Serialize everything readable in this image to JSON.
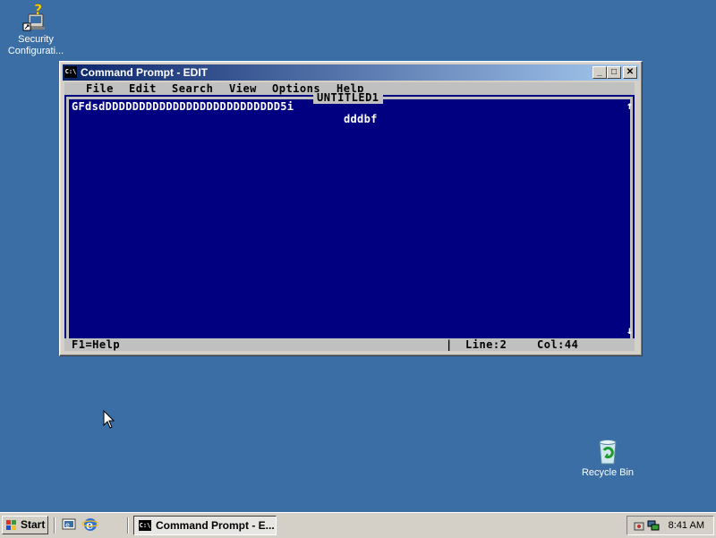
{
  "desktop": {
    "icons": [
      {
        "label": "Security Configurati..."
      },
      {
        "label": "Recycle Bin"
      }
    ]
  },
  "window": {
    "title": "Command Prompt - EDIT",
    "icon_text": "C:\\",
    "buttons": {
      "minimize": "_",
      "maximize": "□",
      "close": "✕"
    }
  },
  "editor": {
    "menu": [
      "File",
      "Edit",
      "Search",
      "View",
      "Options",
      "Help"
    ],
    "document_title": "UNTITLED1",
    "lines": [
      "GFdsdDDDDDDDDDDDDDDDDDDDDDDDDDD5i",
      "dddbf"
    ],
    "scroll_up": "↑",
    "scroll_down": "↓",
    "status": {
      "help": "F1=Help",
      "line": "Line:2",
      "col": "Col:44"
    }
  },
  "taskbar": {
    "start_label": "Start",
    "task_label": "Command Prompt - E...",
    "clock": "8:41 AM"
  },
  "colors": {
    "desktop": "#3a6ea5",
    "editor_bg": "#000080",
    "titlebar_start": "#0a246a",
    "titlebar_end": "#a6caf0"
  }
}
